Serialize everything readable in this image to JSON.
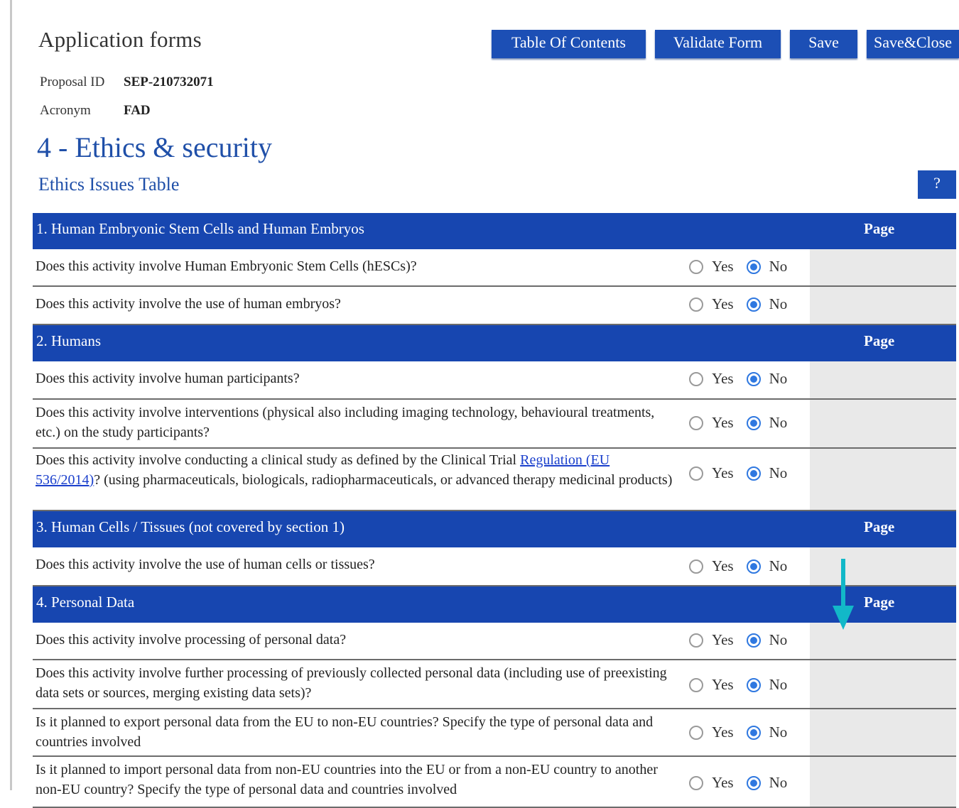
{
  "header": {
    "title": "Application forms",
    "buttons": {
      "toc": "Table Of Contents",
      "validate": "Validate Form",
      "save": "Save",
      "save_close": "Save&Close"
    },
    "proposal_id_label": "Proposal ID",
    "proposal_id": "SEP-210732071",
    "acronym_label": "Acronym",
    "acronym": "FAD"
  },
  "section": {
    "title": "4 - Ethics & security",
    "subtitle": "Ethics Issues Table",
    "help": "?"
  },
  "yes_label": "Yes",
  "no_label": "No",
  "page_label": "Page",
  "groups": [
    {
      "title": "1. Human Embryonic Stem Cells and Human Embryos",
      "questions": [
        {
          "text": "Does this activity involve Human Embryonic Stem Cells (hESCs)?",
          "answer": "No"
        },
        {
          "text": "Does this activity involve the use of human embryos?",
          "answer": "No"
        }
      ]
    },
    {
      "title": "2. Humans",
      "questions": [
        {
          "text": "Does this activity involve human participants?",
          "answer": "No"
        },
        {
          "text": "Does this activity involve interventions (physical also including imaging technology, behavioural treatments, etc.) on the study participants?",
          "answer": "No"
        },
        {
          "text_pre": "Does this activity involve conducting a clinical study as defined by the Clinical Trial ",
          "link": "Regulation (EU 536/2014)",
          "text_post": "? (using pharmaceuticals, biologicals, radiopharmaceuticals, or advanced therapy medicinal products)",
          "answer": "No"
        }
      ]
    },
    {
      "title": "3. Human Cells / Tissues (not covered by section 1)",
      "questions": [
        {
          "text": "Does this activity involve the use of human cells or tissues?",
          "answer": "No"
        }
      ]
    },
    {
      "title": "4. Personal Data",
      "questions": [
        {
          "text": "Does this activity involve processing of personal data?",
          "answer": "No"
        },
        {
          "text": "Does this activity involve further processing of previously collected personal data (including use of preexisting data sets or sources, merging existing data sets)?",
          "answer": "No"
        },
        {
          "text": "Is it planned to export personal data from the EU to non-EU countries? Specify the type of personal data and countries involved",
          "answer": "No"
        },
        {
          "text": "Is it planned to import personal data from non-EU countries into the EU or from a non-EU country to another non-EU country? Specify the type of personal data and countries involved",
          "answer": "No"
        }
      ]
    }
  ],
  "colors": {
    "header_blue": "#1746b0",
    "button_blue": "#1c4fb5",
    "title_blue": "#1f4fa8",
    "annotation_arrow": "#12b8c8"
  }
}
